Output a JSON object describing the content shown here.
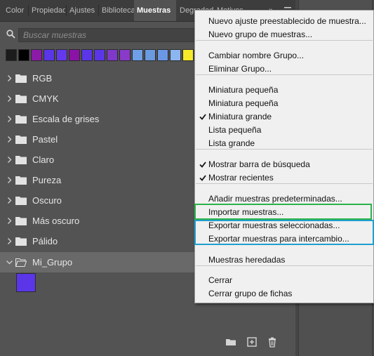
{
  "tabs": [
    {
      "label": "Color",
      "active": false
    },
    {
      "label": "Propiedades",
      "active": false
    },
    {
      "label": "Ajustes",
      "active": false
    },
    {
      "label": "Bibliotecas",
      "active": false
    },
    {
      "label": "Muestras",
      "active": true
    },
    {
      "label": "Degradados",
      "active": false
    },
    {
      "label": "Motivos",
      "active": false
    }
  ],
  "tab_overflow": "»",
  "panel_menu_icon": "hamburger-icon",
  "search": {
    "placeholder": "Buscar muestras",
    "icon": "search-icon"
  },
  "recent_swatches": [
    "#1c1c1c",
    "#000000",
    "#8c1aa8",
    "#5b36e8",
    "#6438ec",
    "#8a12a6",
    "#5b36e8",
    "#5b36e8",
    "#7f38c9",
    "#8a3ac9",
    "#6f9fe6",
    "#6a9ae0",
    "#6a98e4",
    "#8cb6f0",
    "#f5e92a"
  ],
  "groups": [
    {
      "label": "RGB",
      "expanded": false
    },
    {
      "label": "CMYK",
      "expanded": false
    },
    {
      "label": "Escala de grises",
      "expanded": false
    },
    {
      "label": "Pastel",
      "expanded": false
    },
    {
      "label": "Claro",
      "expanded": false
    },
    {
      "label": "Pureza",
      "expanded": false
    },
    {
      "label": "Oscuro",
      "expanded": false
    },
    {
      "label": "Más oscuro",
      "expanded": false
    },
    {
      "label": "Pálido",
      "expanded": false
    },
    {
      "label": "Mi_Grupo",
      "expanded": true,
      "selected": true
    }
  ],
  "group_swatch_color": "#5b36e8",
  "footer_icons": [
    "new-group-folder-icon",
    "new-swatch-icon",
    "trash-icon"
  ],
  "menu": {
    "sections": [
      [
        "Nuevo ajuste preestablecido de muestra...",
        "Nuevo grupo de muestras..."
      ],
      [
        "Cambiar nombre Grupo...",
        "Eliminar Grupo..."
      ],
      [
        "Miniatura pequeña",
        "Miniatura pequeña",
        "Miniatura grande",
        "Lista pequeña",
        "Lista grande"
      ],
      [
        "Mostrar barra de búsqueda",
        "Mostrar recientes"
      ],
      [
        "Añadir muestras predeterminadas...",
        "Importar muestras...",
        "Exportar muestras seleccionadas...",
        "Exportar muestras para intercambio..."
      ],
      [
        "Muestras heredadas"
      ],
      [
        "Cerrar",
        "Cerrar grupo de fichas"
      ]
    ],
    "checked": [
      "Miniatura grande",
      "Mostrar barra de búsqueda",
      "Mostrar recientes"
    ]
  },
  "highlight_colors": {
    "green": "#2cb24a",
    "blue": "#1f9fd0"
  }
}
